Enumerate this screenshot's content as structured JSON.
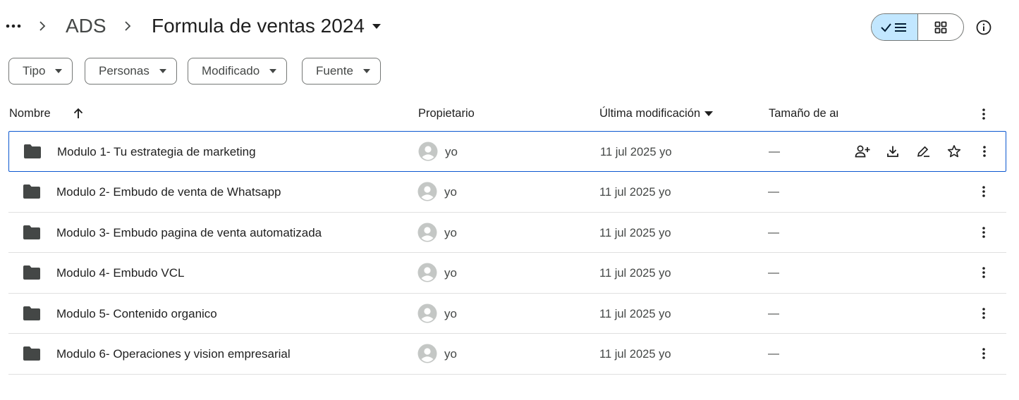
{
  "breadcrumb": {
    "parent": "ADS",
    "current": "Formula de ventas 2024"
  },
  "filters": [
    {
      "label": "Tipo"
    },
    {
      "label": "Personas"
    },
    {
      "label": "Modificado"
    },
    {
      "label": "Fuente"
    }
  ],
  "columns": {
    "name": "Nombre",
    "owner": "Propietario",
    "modified": "Última modificación",
    "size": "Tamaño de archivo"
  },
  "rows": [
    {
      "name": "Modulo 1- Tu estrategia de marketing",
      "owner": "yo",
      "modified": "11 jul 2025",
      "modified_by": "yo",
      "size": "—"
    },
    {
      "name": "Modulo 2- Embudo de venta de Whatsapp",
      "owner": "yo",
      "modified": "11 jul 2025",
      "modified_by": "yo",
      "size": "—"
    },
    {
      "name": "Modulo 3- Embudo pagina de venta automatizada",
      "owner": "yo",
      "modified": "11 jul 2025",
      "modified_by": "yo",
      "size": "—"
    },
    {
      "name": "Modulo 4- Embudo VCL",
      "owner": "yo",
      "modified": "11 jul 2025",
      "modified_by": "yo",
      "size": "—"
    },
    {
      "name": "Modulo 5- Contenido organico",
      "owner": "yo",
      "modified": "11 jul 2025",
      "modified_by": "yo",
      "size": "—"
    },
    {
      "name": "Modulo 6- Operaciones y vision empresarial",
      "owner": "yo",
      "modified": "11 jul 2025",
      "modified_by": "yo",
      "size": "—"
    }
  ],
  "selected_row": 0,
  "icons": {
    "more": "more-horiz-icon",
    "chevron": "chevron-right-icon",
    "folder": "folder-icon",
    "avatar": "account-circle-icon",
    "share": "person-add-icon",
    "download": "download-icon",
    "rename": "edit-icon",
    "star": "star-outline-icon",
    "row_more": "more-vert-icon",
    "list_view": "list-view-icon",
    "grid_view": "grid-view-icon",
    "info": "info-icon",
    "sort": "arrow-upward-icon"
  },
  "colors": {
    "accent": "#0b57d0",
    "toggle_active": "#c2e7ff",
    "text_primary": "#1f1f1f",
    "text_secondary": "#444746",
    "icon_gray": "#c4c7c5"
  }
}
